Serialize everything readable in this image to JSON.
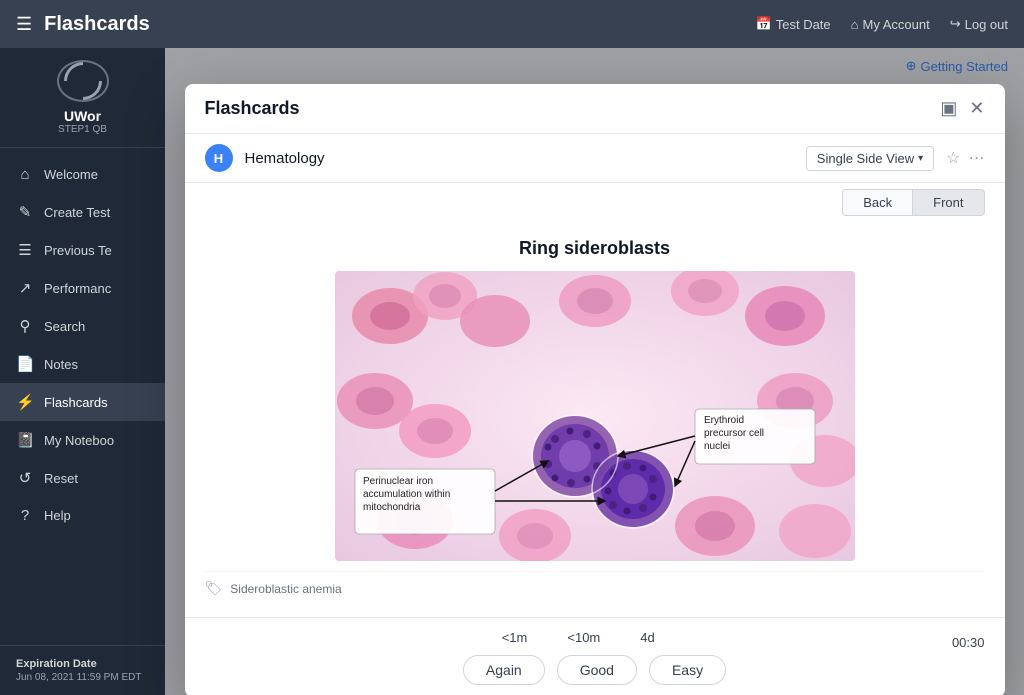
{
  "header": {
    "menu_icon": "☰",
    "title": "Flashcards",
    "test_date": "Test Date",
    "my_account": "My Account",
    "logout": "Log out"
  },
  "sidebar": {
    "brand": "UWor",
    "sub": "STEP1 QB",
    "items": [
      {
        "label": "Welcome",
        "icon": "⌂",
        "active": false
      },
      {
        "label": "Create Test",
        "icon": "✎",
        "active": false
      },
      {
        "label": "Previous Te",
        "icon": "☰",
        "active": false
      },
      {
        "label": "Performanc",
        "icon": "↗",
        "active": false
      },
      {
        "label": "Search",
        "icon": "⚲",
        "active": false
      },
      {
        "label": "Notes",
        "icon": "📄",
        "active": false
      },
      {
        "label": "Flashcards",
        "icon": "⚡",
        "active": true
      },
      {
        "label": "My Noteboo",
        "icon": "📓",
        "active": false
      },
      {
        "label": "Reset",
        "icon": "↺",
        "active": false
      },
      {
        "label": "Help",
        "icon": "?",
        "active": false
      }
    ],
    "expiration_label": "Expiration Date",
    "expiration_date": "Jun 08, 2021 11:59 PM EDT"
  },
  "getting_started": {
    "icon": "⊕",
    "label": "Getting Started"
  },
  "modal": {
    "title": "Flashcards",
    "minimize_icon": "▣",
    "close_icon": "✕",
    "hematology_badge": "H",
    "subject": "Hematology",
    "view_label": "Single Side View",
    "star_icon": "☆",
    "more_icon": "⋯",
    "back_label": "Back",
    "front_label": "Front",
    "card_title": "Ring sideroblasts",
    "annotations": [
      {
        "label": "Erythroid precursor cell nuclei"
      },
      {
        "label": "Perinuclear iron accumulation within mitochondria"
      }
    ],
    "tag_icon": "🏷",
    "tag": "Sideroblastic anemia",
    "timing": [
      {
        "value": "<1m",
        "interval": ""
      },
      {
        "value": "<10m",
        "interval": ""
      },
      {
        "value": "4d",
        "interval": ""
      }
    ],
    "timer": "00:30",
    "buttons": [
      {
        "label": "Again"
      },
      {
        "label": "Good"
      },
      {
        "label": "Easy"
      }
    ]
  }
}
